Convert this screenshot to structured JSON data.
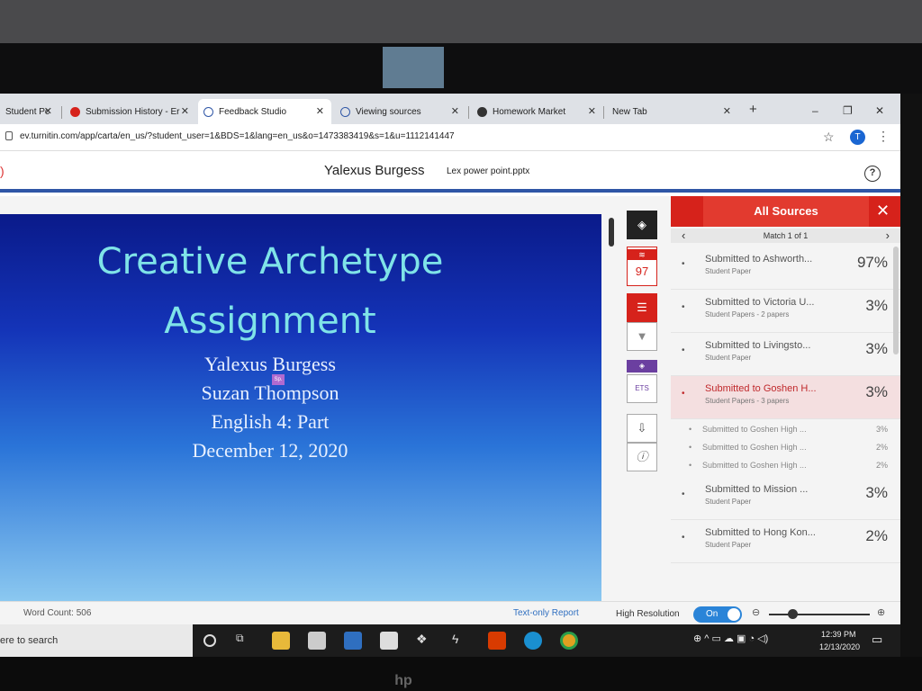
{
  "browser": {
    "tabs": [
      {
        "label": "Student Pc",
        "active": false
      },
      {
        "label": "Submission History - Er",
        "active": false
      },
      {
        "label": "Feedback Studio",
        "active": true
      },
      {
        "label": "Viewing sources",
        "active": false
      },
      {
        "label": "Homework Market",
        "active": false
      },
      {
        "label": "New Tab",
        "active": false
      }
    ],
    "new_tab": "+",
    "url": "ev.turnitin.com/app/carta/en_us/?student_user=1&BDS=1&lang=en_us&o=1473383419&s=1&u=1112141447",
    "profile_initial": "T"
  },
  "header": {
    "student_name": "Yalexus Burgess",
    "file_name": "Lex power point.pptx",
    "help": "?"
  },
  "slide": {
    "title_line1": "Creative Archetype",
    "title_line2": "Assignment",
    "lines": [
      "Yalexus Burgess",
      "Suzan Thompson",
      "English 4: Part",
      "December 12, 2020"
    ],
    "mark": "Sp."
  },
  "toolbar": {
    "score": "97",
    "ets": "ETS"
  },
  "sources_panel": {
    "title": "All Sources",
    "match_label": "Match 1 of 1",
    "sources": [
      {
        "name": "Submitted to Ashworth...",
        "sub": "Student Paper",
        "pct": "97%"
      },
      {
        "name": "Submitted to Victoria U...",
        "sub": "Student Papers - 2 papers",
        "pct": "3%"
      },
      {
        "name": "Submitted to Livingsto...",
        "sub": "Student Paper",
        "pct": "3%"
      },
      {
        "name": "Submitted to Goshen H...",
        "sub": "Student Papers - 3 papers",
        "pct": "3%"
      },
      {
        "name": "Submitted to Mission ...",
        "sub": "Student Paper",
        "pct": "3%"
      },
      {
        "name": "Submitted to Hong Kon...",
        "sub": "Student Paper",
        "pct": "2%"
      }
    ],
    "subsources": [
      {
        "name": "Submitted to Goshen High ...",
        "pct": "3%"
      },
      {
        "name": "Submitted to Goshen High ...",
        "pct": "2%"
      },
      {
        "name": "Submitted to Goshen High ...",
        "pct": "2%"
      }
    ],
    "accent_color": "#d6221b"
  },
  "statusbar": {
    "word_count": "Word Count: 506",
    "text_only": "Text-only Report",
    "high_res_label": "High Resolution",
    "toggle": "On"
  },
  "taskbar": {
    "search_placeholder": "ere to search",
    "time": "12:39 PM",
    "date": "12/13/2020"
  }
}
